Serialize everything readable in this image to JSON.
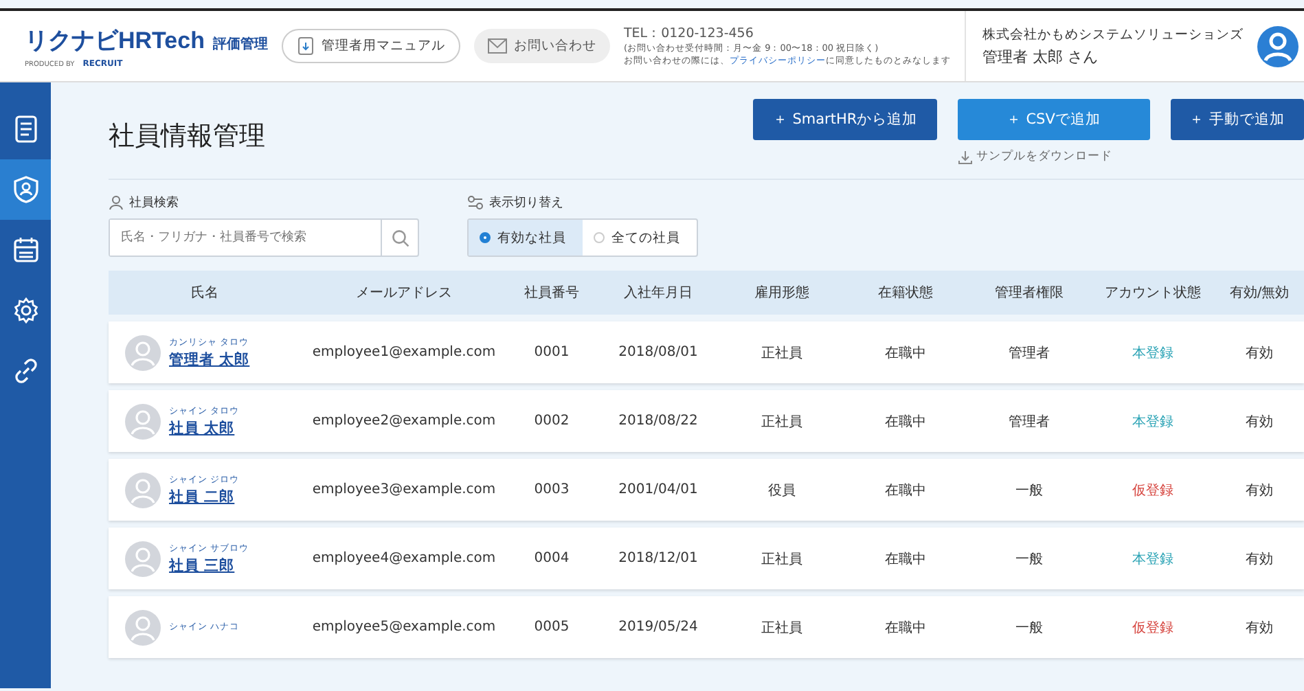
{
  "header": {
    "logo": "リクナビHRTech",
    "logo_sub": "評価管理",
    "produced_by": "PRODUCED BY",
    "brand": "RECRUIT",
    "manual_button": "管理者用マニュアル",
    "contact_button": "お問い合わせ",
    "tel": "TEL：0120-123-456",
    "hours": "(お問い合わせ受付時間：月〜金 9：00〜18：00 祝日除く)",
    "privacy_before": "お問い合わせの際には、",
    "privacy_link": "プライバシーポリシー",
    "privacy_after": "に同意したものとみなします",
    "company": "株式会社かもめシステムソリューションズ",
    "user": "管理者 太郎 さん"
  },
  "sidebar": {
    "items": [
      {
        "selected": false
      },
      {
        "selected": true
      },
      {
        "selected": false
      },
      {
        "selected": false
      },
      {
        "selected": false
      }
    ]
  },
  "page_title": "社員情報管理",
  "actions": [
    {
      "label": "＋ SmartHRから追加",
      "kind": "dark"
    },
    {
      "label": "＋ CSVで追加",
      "kind": "light"
    },
    {
      "label": "＋ 手動で追加",
      "kind": "dark"
    }
  ],
  "sample_download": "サンプルをダウンロード",
  "search": {
    "label": "社員検索",
    "placeholder": "氏名・フリガナ・社員番号で検索"
  },
  "filter": {
    "label": "表示切り替え",
    "options": [
      {
        "label": "有効な社員",
        "selected": true
      },
      {
        "label": "全ての社員",
        "selected": false
      }
    ]
  },
  "table": {
    "columns": [
      "氏名",
      "メールアドレス",
      "社員番号",
      "入社年月日",
      "雇用形態",
      "在籍状態",
      "管理者権限",
      "アカウント状態",
      "有効/無効"
    ],
    "rows": [
      {
        "kana": "カンリシャ タロウ",
        "name": "管理者 太郎",
        "email": "employee1@example.com",
        "number": "0001",
        "joined": "2018/08/01",
        "employment": "正社員",
        "status": "在職中",
        "role": "管理者",
        "account": "本登録",
        "color": "#2aa3b5",
        "active": "有効"
      },
      {
        "kana": "シャイン タロウ",
        "name": "社員 太郎",
        "email": "employee2@example.com",
        "number": "0002",
        "joined": "2018/08/22",
        "employment": "正社員",
        "status": "在職中",
        "role": "管理者",
        "account": "本登録",
        "color": "#2aa3b5",
        "active": "有効"
      },
      {
        "kana": "シャイン ジロウ",
        "name": "社員 二郎",
        "email": "employee3@example.com",
        "number": "0003",
        "joined": "2001/04/01",
        "employment": "役員",
        "status": "在職中",
        "role": "一般",
        "account": "仮登録",
        "color": "#d6453f",
        "active": "有効"
      },
      {
        "kana": "シャイン サブロウ",
        "name": "社員 三郎",
        "email": "employee4@example.com",
        "number": "0004",
        "joined": "2018/12/01",
        "employment": "正社員",
        "status": "在職中",
        "role": "一般",
        "account": "本登録",
        "color": "#2aa3b5",
        "active": "有効"
      },
      {
        "kana": "シャイン ハナコ",
        "email": "employee5@example.com",
        "number": "0005",
        "joined": "2019/05/24",
        "employment": "正社員",
        "status": "在職中",
        "role": "一般",
        "account": "仮登録",
        "color": "#d6453f",
        "active": "有効"
      }
    ]
  }
}
